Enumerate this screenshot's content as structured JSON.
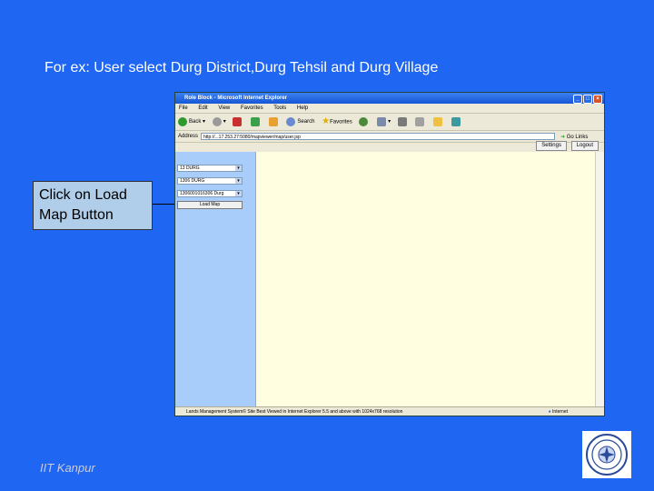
{
  "slide": {
    "title": "For ex: User select Durg District,Durg Tehsil and Durg Village",
    "callout": "Click on Load Map Button",
    "footer": "IIT Kanpur"
  },
  "browser": {
    "window_title": "Role Block - Microsoft Internet Explorer",
    "menu": [
      "File",
      "Edit",
      "View",
      "Favorites",
      "Tools",
      "Help"
    ],
    "toolbar": {
      "back": "Back",
      "search": "Search",
      "favorites": "Favorites"
    },
    "address_label": "Address",
    "address_value": "http://...17.253.27:5080/mapviewer/map/user.jsp",
    "go_label": "Go",
    "links_label": "Links"
  },
  "app": {
    "settings_label": "Settings",
    "logout_label": "Logout",
    "district_select": "13 DURG",
    "tehsil_select": "1306 DURG",
    "village_select": "1306001016306 Durg",
    "load_map_label": "Load Map"
  },
  "status": {
    "text": "Lands Management System© Site Best Viewed in Internet Explorer 5.5 and above with 1024x768 resolution",
    "zone": "Internet"
  },
  "colors": {
    "slide_bg": "#1f66f2",
    "callout_bg": "#b0cdea",
    "content_bg": "#fffee0",
    "panel_bg": "#a9cdfa"
  }
}
